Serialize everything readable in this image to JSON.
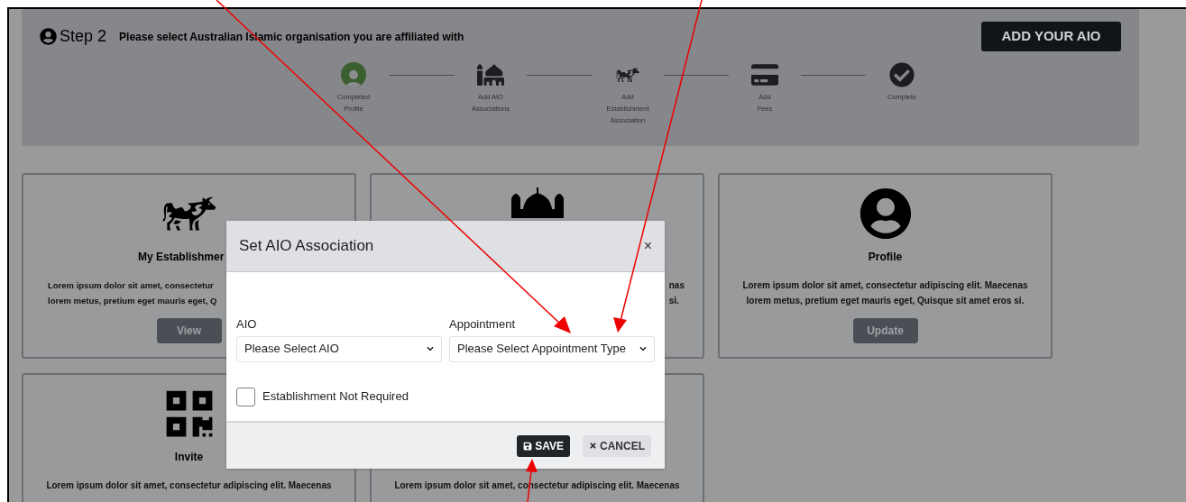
{
  "header": {
    "step_label": "Step 2",
    "instruction": "Please select Australian Islamic organisation you are affiliated with",
    "add_button": "ADD YOUR AIO"
  },
  "steps": [
    {
      "kind": "profile",
      "label_lines": [
        "Completed",
        "Profile"
      ],
      "completed": true
    },
    {
      "kind": "mosque",
      "label_lines": [
        "Add AIO",
        "Associations"
      ],
      "completed": false
    },
    {
      "kind": "cow",
      "label_lines": [
        "Add",
        "Establishment",
        "Association"
      ],
      "completed": false
    },
    {
      "kind": "card",
      "label_lines": [
        "Add",
        "Fees"
      ],
      "completed": false
    },
    {
      "kind": "check",
      "label_lines": [
        "Complete"
      ],
      "completed": false
    }
  ],
  "cards": [
    {
      "kind": "establishment",
      "title": "My Establishmer",
      "description_lines": [
        "Lorem ipsum dolor sit amet, consectetur",
        "lorem metus, pretium eget mauris eget, Q"
      ],
      "button": "View"
    },
    {
      "kind": "aio",
      "description_lines": [
        "nas",
        "si."
      ]
    },
    {
      "kind": "profile",
      "title": "Profile",
      "description_lines": [
        "Lorem ipsum dolor sit amet, consectetur adipiscing elit. Maecenas",
        "lorem metus, pretium eget mauris eget, Quisque sit amet eros si."
      ],
      "button": "Update"
    },
    {
      "kind": "invite",
      "title": "Invite",
      "description_lines": [
        "Lorem ipsum dolor sit amet, consectetur adipiscing elit. Maecenas"
      ]
    },
    {
      "kind": "blank",
      "description_lines": [
        "Lorem ipsum dolor sit amet, consectetur adipiscing elit. Maecenas"
      ]
    }
  ],
  "modal": {
    "title": "Set AIO Association",
    "close": "×",
    "fields": [
      {
        "label": "AIO",
        "value": "Please Select AIO"
      },
      {
        "label": "Appointment",
        "value": "Please Select Appointment Type"
      }
    ],
    "checkbox": {
      "label": "Establishment Not Required",
      "checked": false
    },
    "save_button": "SAVE",
    "cancel_button": "CANCEL"
  }
}
